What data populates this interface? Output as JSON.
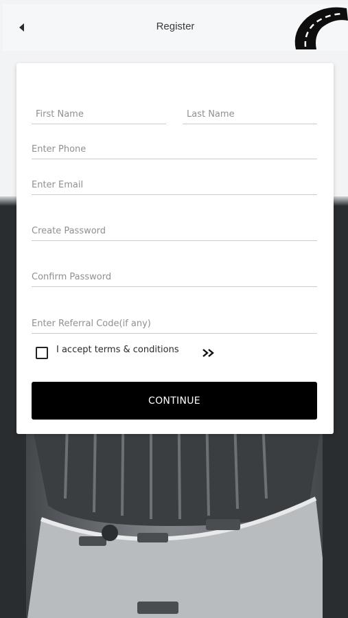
{
  "header": {
    "title": "Register"
  },
  "form": {
    "first_name_placeholder": "First Name",
    "last_name_placeholder": "Last Name",
    "phone_placeholder": "Enter Phone",
    "email_placeholder": "Enter Email",
    "password_placeholder": "Create Password",
    "confirm_password_placeholder": "Confirm Password",
    "referral_placeholder": "Enter Referral Code(if any)",
    "terms_label": "I accept terms & conditions",
    "terms_checked": false,
    "continue_label": "CONTINUE"
  },
  "icons": {
    "back": "back-arrow-icon",
    "terms": "double-chevron-right-icon",
    "logo": "road-logo-icon"
  },
  "colors": {
    "button_bg": "#000000",
    "button_text": "#ffffff",
    "card_bg": "#ffffff"
  }
}
